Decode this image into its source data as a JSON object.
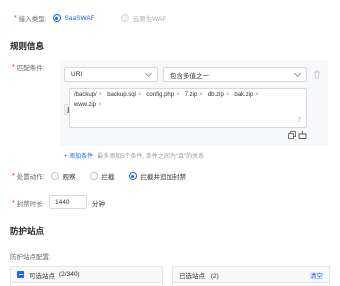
{
  "access": {
    "label": "接入类型:",
    "options": [
      {
        "label": "SaaSWAF",
        "selected": true,
        "disabled": false
      },
      {
        "label": "云原生WAF",
        "selected": false,
        "disabled": true
      }
    ]
  },
  "rule_section_title": "规则信息",
  "match": {
    "label": "匹配条件:",
    "field_value": "URI",
    "operator_value": "包含多值之一",
    "and_badge": "且",
    "tags": [
      "/backup/",
      "backup.sql",
      "config.php",
      "7.zip",
      "db.zip",
      "bak.zip",
      "www.zip"
    ],
    "tag_remove_glyph": "×",
    "count": "7",
    "add_link_label": "+ 添加条件",
    "add_hint": "最多添加5个条件, 条件之间为\"且\"的关系"
  },
  "action": {
    "label": "处置动作:",
    "options": [
      {
        "label": "观察",
        "selected": false
      },
      {
        "label": "拦截",
        "selected": false
      },
      {
        "label": "拦截并追加封禁",
        "selected": true
      }
    ]
  },
  "ban": {
    "label": "封禁时长",
    "value": "1440",
    "unit": "分钟"
  },
  "protect_section_title": "防护站点",
  "site_config_label": "防护站点配置:",
  "available_panel": {
    "title": "可选站点",
    "count": "(2/340)"
  },
  "selected_panel": {
    "title": "已选站点",
    "count": "(2)",
    "clear_label": "清空"
  },
  "colors": {
    "accent": "#1a63ff",
    "required": "#f5222d"
  }
}
